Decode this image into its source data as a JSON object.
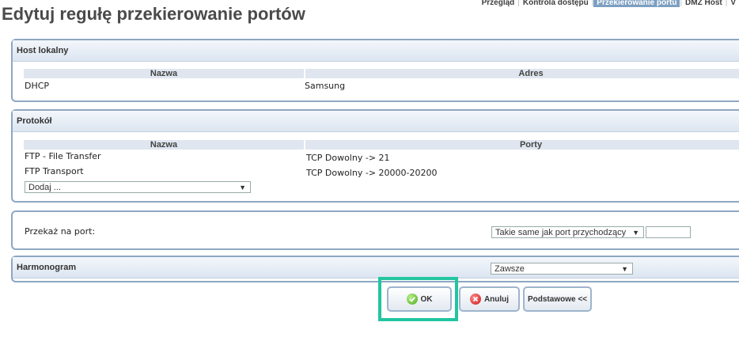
{
  "page": {
    "title": "Edytuj regułę przekierowanie portów"
  },
  "topnav": {
    "items": [
      {
        "label": "Przegląd"
      },
      {
        "label": "Kontrola dostępu"
      },
      {
        "label": "Przekierowanie portu",
        "active": true
      },
      {
        "label": "DMZ Host"
      },
      {
        "label": "V"
      }
    ]
  },
  "host": {
    "title": "Host lokalny",
    "columns": {
      "name": "Nazwa",
      "address": "Adres"
    },
    "row": {
      "name": "DHCP",
      "address": "Samsung"
    }
  },
  "protocol": {
    "title": "Protokół",
    "columns": {
      "name": "Nazwa",
      "ports": "Porty"
    },
    "rows": [
      {
        "name": "FTP - File Transfer",
        "ports": "TCP Dowolny -> 21"
      },
      {
        "name": "FTP Transport",
        "ports": "TCP Dowolny -> 20000-20200"
      }
    ],
    "add_select": "Dodaj ..."
  },
  "forward": {
    "label": "Przekaż na port:",
    "select": "Takie same jak port przychodzący",
    "port_value": ""
  },
  "schedule": {
    "title": "Harmonogram",
    "select": "Zawsze"
  },
  "buttons": {
    "ok": "OK",
    "cancel": "Anuluj",
    "basic": "Podstawowe <<"
  },
  "colors": {
    "box_border": "#8ea7c2",
    "highlight": "#22c5a0",
    "active_nav": "#7d9fc1"
  }
}
